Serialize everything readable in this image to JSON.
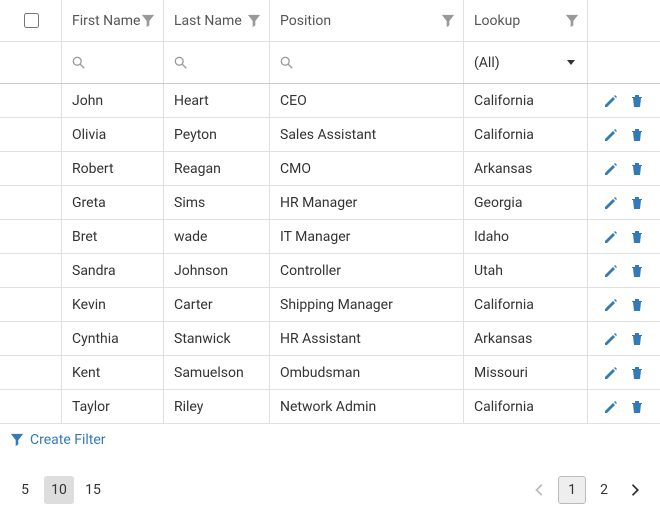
{
  "columns": {
    "first_name": "First Name",
    "last_name": "Last Name",
    "position": "Position",
    "lookup": "Lookup"
  },
  "lookup_filter": "(All)",
  "rows": [
    {
      "first_name": "John",
      "last_name": "Heart",
      "position": "CEO",
      "lookup": "California"
    },
    {
      "first_name": "Olivia",
      "last_name": "Peyton",
      "position": "Sales Assistant",
      "lookup": "California"
    },
    {
      "first_name": "Robert",
      "last_name": "Reagan",
      "position": "CMO",
      "lookup": "Arkansas"
    },
    {
      "first_name": "Greta",
      "last_name": "Sims",
      "position": "HR Manager",
      "lookup": "Georgia"
    },
    {
      "first_name": "Bret",
      "last_name": "wade",
      "position": "IT Manager",
      "lookup": "Idaho"
    },
    {
      "first_name": "Sandra",
      "last_name": "Johnson",
      "position": "Controller",
      "lookup": "Utah"
    },
    {
      "first_name": "Kevin",
      "last_name": "Carter",
      "position": "Shipping Manager",
      "lookup": "California"
    },
    {
      "first_name": "Cynthia",
      "last_name": "Stanwick",
      "position": "HR Assistant",
      "lookup": "Arkansas"
    },
    {
      "first_name": "Kent",
      "last_name": "Samuelson",
      "position": "Ombudsman",
      "lookup": "Missouri"
    },
    {
      "first_name": "Taylor",
      "last_name": "Riley",
      "position": "Network Admin",
      "lookup": "California"
    }
  ],
  "footer": {
    "create_filter": "Create Filter"
  },
  "pager": {
    "sizes": [
      "5",
      "10",
      "15"
    ],
    "active_size": "10",
    "pages": [
      "1",
      "2"
    ],
    "active_page": "1"
  }
}
